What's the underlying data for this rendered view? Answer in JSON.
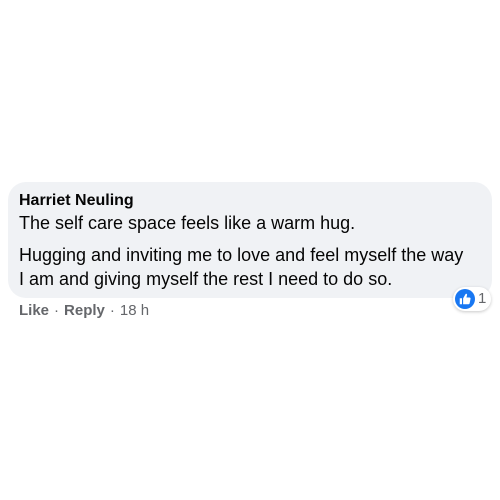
{
  "comment": {
    "author": "Harriet Neuling",
    "paragraphs": [
      "The self care space feels like a warm hug.",
      "Hugging and inviting me to love and feel myself the way I am and giving myself the rest I need to do so."
    ]
  },
  "reactions": {
    "icon": "like-thumbs-up-icon",
    "count": "1",
    "color": "#1877f2"
  },
  "actions": {
    "like_label": "Like",
    "separator": "·",
    "reply_label": "Reply",
    "timestamp": "18 h"
  },
  "colors": {
    "bubble": "#f0f2f5",
    "text": "#050505",
    "secondary_text": "#65676b",
    "accent": "#1877f2"
  }
}
